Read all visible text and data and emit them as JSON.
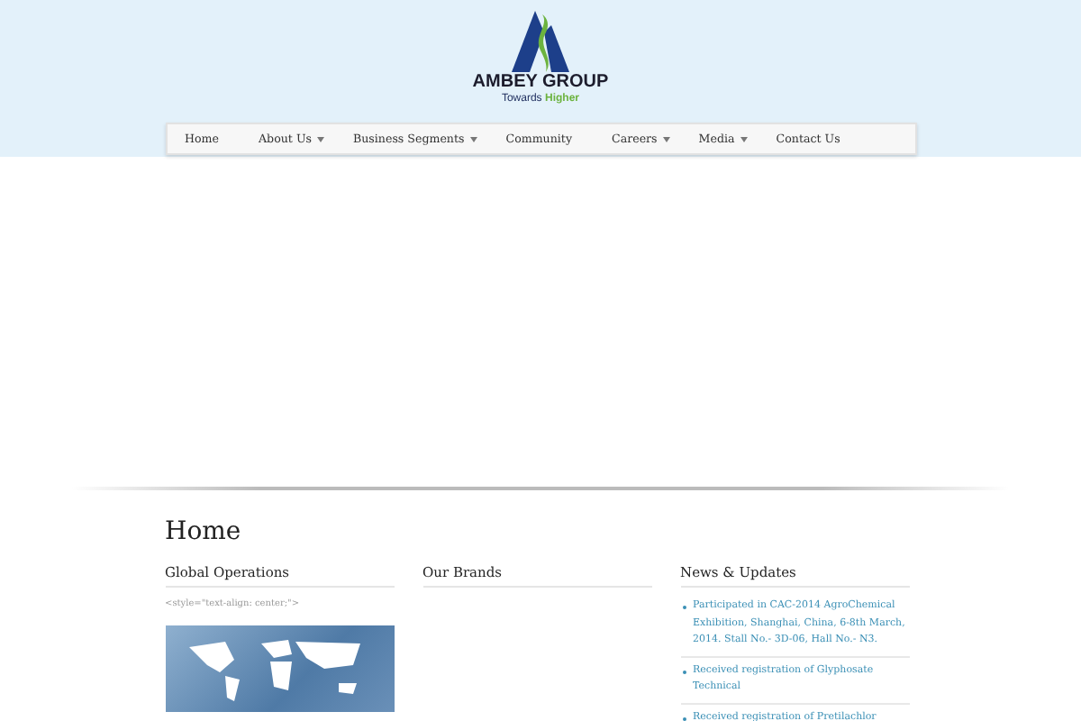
{
  "logo": {
    "name": "AMBEY GROUP",
    "tagline_start": "Towards",
    "tagline_end": "Higher"
  },
  "nav": [
    {
      "label": "Home",
      "dropdown": false
    },
    {
      "label": "About Us",
      "dropdown": true
    },
    {
      "label": "Business Segments",
      "dropdown": true
    },
    {
      "label": "Community",
      "dropdown": false
    },
    {
      "label": "Careers",
      "dropdown": true
    },
    {
      "label": "Media",
      "dropdown": true
    },
    {
      "label": "Contact Us",
      "dropdown": false
    }
  ],
  "page_title": "Home",
  "columns": [
    {
      "heading": "Global Operations",
      "kind": "map",
      "text": "<style=\"text-align: center;\">"
    },
    {
      "heading": "Our Brands",
      "kind": "empty"
    },
    {
      "heading": "News & Updates",
      "kind": "news",
      "items": [
        "Participated in CAC-2014 AgroChemical Exhibition, Shanghai, China, 6-8th March, 2014. Stall No.- 3D-06, Hall No.- N3.",
        "Received registration of Glyphosate Technical",
        "Received registration of Pretilachlor"
      ]
    }
  ]
}
